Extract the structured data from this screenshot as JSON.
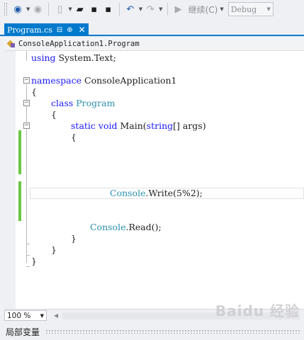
{
  "toolbar": {
    "run_label": "继续(C)",
    "config_value": "Debug"
  },
  "tab": {
    "title": "Program.cs",
    "pin_glyph": "⊟",
    "float_glyph": "⊕",
    "close_glyph": "✕"
  },
  "navbar": {
    "path": "ConsoleApplication1.Program"
  },
  "code": {
    "line_using_kw": "using",
    "line_using_rest": " System.Text;",
    "ns_kw": "namespace",
    "ns_name": " ConsoleApplication1",
    "brace_open": "{",
    "brace_close": "}",
    "class_kw": "class",
    "class_name": "Program",
    "static_kw": "static",
    "void_kw": "void",
    "main_name": " Main(",
    "string_kw": "string",
    "main_args": "[] args)",
    "console1": "Console",
    "write_call": ".Write(5%2);",
    "console2": "Console",
    "read_call": ".Read();"
  },
  "zoom": {
    "value": "100 %"
  },
  "watermark": "Baidu 经验",
  "panel": {
    "title": "局部变量"
  },
  "colors": {
    "accent": "#007acc",
    "keyword": "#1a1aff",
    "type": "#2b91af",
    "change_bar": "#6cc644"
  }
}
